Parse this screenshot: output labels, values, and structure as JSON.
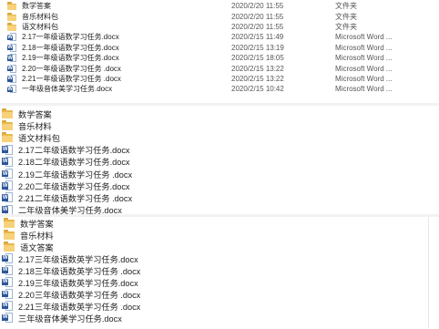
{
  "panel_detailed": {
    "rows": [
      {
        "icon": "folder-icon",
        "name": "数学答案",
        "date": "2020/2/20 11:55",
        "type": "文件夹"
      },
      {
        "icon": "folder-icon",
        "name": "音乐材料包",
        "date": "2020/2/20 11:55",
        "type": "文件夹"
      },
      {
        "icon": "folder-icon",
        "name": "语文材料包",
        "date": "2020/2/20 11:55",
        "type": "文件夹"
      },
      {
        "icon": "word-doc-icon",
        "name": "2.17一年级语数学习任务.docx",
        "date": "2020/2/15 11:49",
        "type": "Microsoft Word ..."
      },
      {
        "icon": "word-doc-icon",
        "name": "2.18一年级语数学习任务.docx",
        "date": "2020/2/15 13:19",
        "type": "Microsoft Word ..."
      },
      {
        "icon": "word-doc-icon",
        "name": "2.19一年级语数学习任务.docx",
        "date": "2020/2/15 18:05",
        "type": "Microsoft Word ..."
      },
      {
        "icon": "word-doc-icon",
        "name": "2.20一年级语数学习任务 .docx",
        "date": "2020/2/15 13:22",
        "type": "Microsoft Word ..."
      },
      {
        "icon": "word-doc-icon",
        "name": "2.21一年级语数学习任务 .docx",
        "date": "2020/2/15 13:22",
        "type": "Microsoft Word ..."
      },
      {
        "icon": "word-doc-icon",
        "name": "一年级音体美学习任务.docx",
        "date": "2020/2/15 10:42",
        "type": "Microsoft Word ..."
      }
    ]
  },
  "panel_grade2": {
    "rows": [
      {
        "icon": "folder-icon",
        "name": "数学答案"
      },
      {
        "icon": "folder-icon",
        "name": "音乐材料"
      },
      {
        "icon": "folder-icon",
        "name": "语文材料包"
      },
      {
        "icon": "word-doc-icon",
        "name": "2.17二年级语数学习任务.docx"
      },
      {
        "icon": "word-doc-icon",
        "name": "2.18二年级语数学习任务.docx"
      },
      {
        "icon": "word-doc-icon",
        "name": "2.19二年级语数学习任务 .docx"
      },
      {
        "icon": "word-doc-icon",
        "name": "2.20二年级语数学习任务.docx"
      },
      {
        "icon": "word-doc-icon",
        "name": "2.21二年级语数学习任务 .docx"
      },
      {
        "icon": "word-doc-icon",
        "name": "二年级音体美学习任务.docx"
      }
    ]
  },
  "panel_grade3": {
    "rows": [
      {
        "icon": "folder-icon",
        "name": "数学答案"
      },
      {
        "icon": "folder-icon",
        "name": "音乐材料"
      },
      {
        "icon": "folder-icon",
        "name": "语文答案"
      },
      {
        "icon": "word-doc-icon",
        "name": "2.17三年级语数英学习任务.docx"
      },
      {
        "icon": "word-doc-icon",
        "name": "2.18三年级语数英学习任务 .docx"
      },
      {
        "icon": "word-doc-icon",
        "name": "2.19三年级语数英学习任务.docx"
      },
      {
        "icon": "word-doc-icon",
        "name": "2.20三年级语数英学习任务 .docx"
      },
      {
        "icon": "word-doc-icon",
        "name": "2.21三年级语数英学习任务 .docx"
      },
      {
        "icon": "word-doc-icon",
        "name": "三年级音体美学习任务.docx"
      }
    ]
  },
  "icons": {
    "word_badge": "W"
  },
  "colors": {
    "folder": "#e8b84a",
    "word": "#2b5797"
  }
}
